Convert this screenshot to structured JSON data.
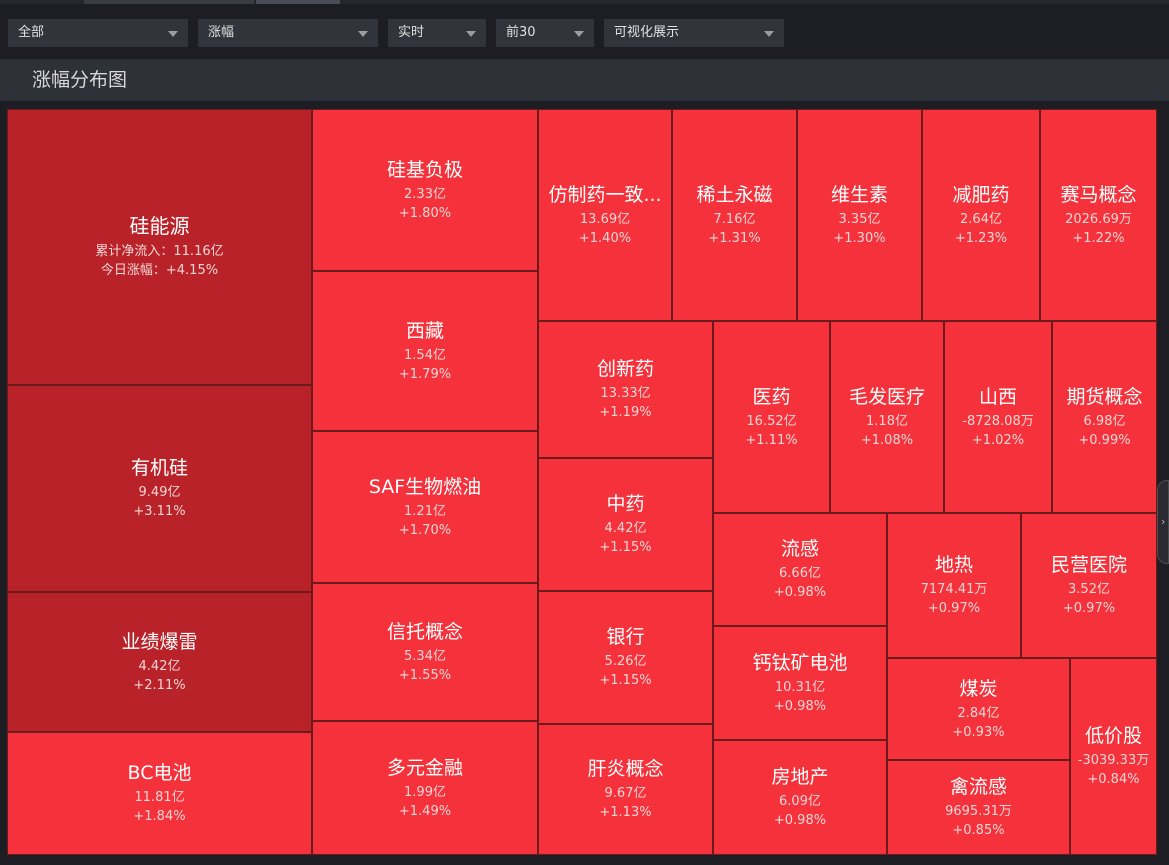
{
  "filters": [
    {
      "id": "scope",
      "value": "全部"
    },
    {
      "id": "metric",
      "value": "涨幅"
    },
    {
      "id": "period",
      "value": "实时"
    },
    {
      "id": "topn",
      "value": "前30"
    },
    {
      "id": "view",
      "value": "可视化展示"
    }
  ],
  "panel": {
    "title": "涨幅分布图"
  },
  "colors": {
    "strong": "#b92229",
    "normal": "#f5323b"
  },
  "treemap": [
    {
      "name": "硅能源",
      "line1": "累计净流入：11.16亿",
      "line2": "今日涨幅：+4.15%",
      "tone": "dark"
    },
    {
      "name": "有机硅",
      "line1": "9.49亿",
      "line2": "+3.11%",
      "tone": "dark"
    },
    {
      "name": "业绩爆雷",
      "line1": "4.42亿",
      "line2": "+2.11%",
      "tone": "dark"
    },
    {
      "name": "BC电池",
      "line1": "11.81亿",
      "line2": "+1.84%",
      "tone": "bright"
    },
    {
      "name": "硅基负极",
      "line1": "2.33亿",
      "line2": "+1.80%",
      "tone": "bright"
    },
    {
      "name": "西藏",
      "line1": "1.54亿",
      "line2": "+1.79%",
      "tone": "bright"
    },
    {
      "name": "SAF生物燃油",
      "line1": "1.21亿",
      "line2": "+1.70%",
      "tone": "bright"
    },
    {
      "name": "信托概念",
      "line1": "5.34亿",
      "line2": "+1.55%",
      "tone": "bright"
    },
    {
      "name": "多元金融",
      "line1": "1.99亿",
      "line2": "+1.49%",
      "tone": "bright"
    },
    {
      "name": "仿制药一致...",
      "line1": "13.69亿",
      "line2": "+1.40%",
      "tone": "bright"
    },
    {
      "name": "稀土永磁",
      "line1": "7.16亿",
      "line2": "+1.31%",
      "tone": "bright"
    },
    {
      "name": "维生素",
      "line1": "3.35亿",
      "line2": "+1.30%",
      "tone": "bright"
    },
    {
      "name": "减肥药",
      "line1": "2.64亿",
      "line2": "+1.23%",
      "tone": "bright"
    },
    {
      "name": "赛马概念",
      "line1": "2026.69万",
      "line2": "+1.22%",
      "tone": "bright"
    },
    {
      "name": "创新药",
      "line1": "13.33亿",
      "line2": "+1.19%",
      "tone": "bright"
    },
    {
      "name": "中药",
      "line1": "4.42亿",
      "line2": "+1.15%",
      "tone": "bright"
    },
    {
      "name": "银行",
      "line1": "5.26亿",
      "line2": "+1.15%",
      "tone": "bright"
    },
    {
      "name": "肝炎概念",
      "line1": "9.67亿",
      "line2": "+1.13%",
      "tone": "bright"
    },
    {
      "name": "医药",
      "line1": "16.52亿",
      "line2": "+1.11%",
      "tone": "bright"
    },
    {
      "name": "毛发医疗",
      "line1": "1.18亿",
      "line2": "+1.08%",
      "tone": "bright"
    },
    {
      "name": "山西",
      "line1": "-8728.08万",
      "line2": "+1.02%",
      "tone": "bright"
    },
    {
      "name": "期货概念",
      "line1": "6.98亿",
      "line2": "+0.99%",
      "tone": "bright"
    },
    {
      "name": "流感",
      "line1": "6.66亿",
      "line2": "+0.98%",
      "tone": "bright"
    },
    {
      "name": "钙钛矿电池",
      "line1": "10.31亿",
      "line2": "+0.98%",
      "tone": "bright"
    },
    {
      "name": "房地产",
      "line1": "6.09亿",
      "line2": "+0.98%",
      "tone": "bright"
    },
    {
      "name": "地热",
      "line1": "7174.41万",
      "line2": "+0.97%",
      "tone": "bright"
    },
    {
      "name": "民营医院",
      "line1": "3.52亿",
      "line2": "+0.97%",
      "tone": "bright"
    },
    {
      "name": "煤炭",
      "line1": "2.84亿",
      "line2": "+0.93%",
      "tone": "bright"
    },
    {
      "name": "禽流感",
      "line1": "9695.31万",
      "line2": "+0.85%",
      "tone": "bright"
    },
    {
      "name": "低价股",
      "line1": "-3039.33万",
      "line2": "+0.84%",
      "tone": "bright"
    }
  ]
}
